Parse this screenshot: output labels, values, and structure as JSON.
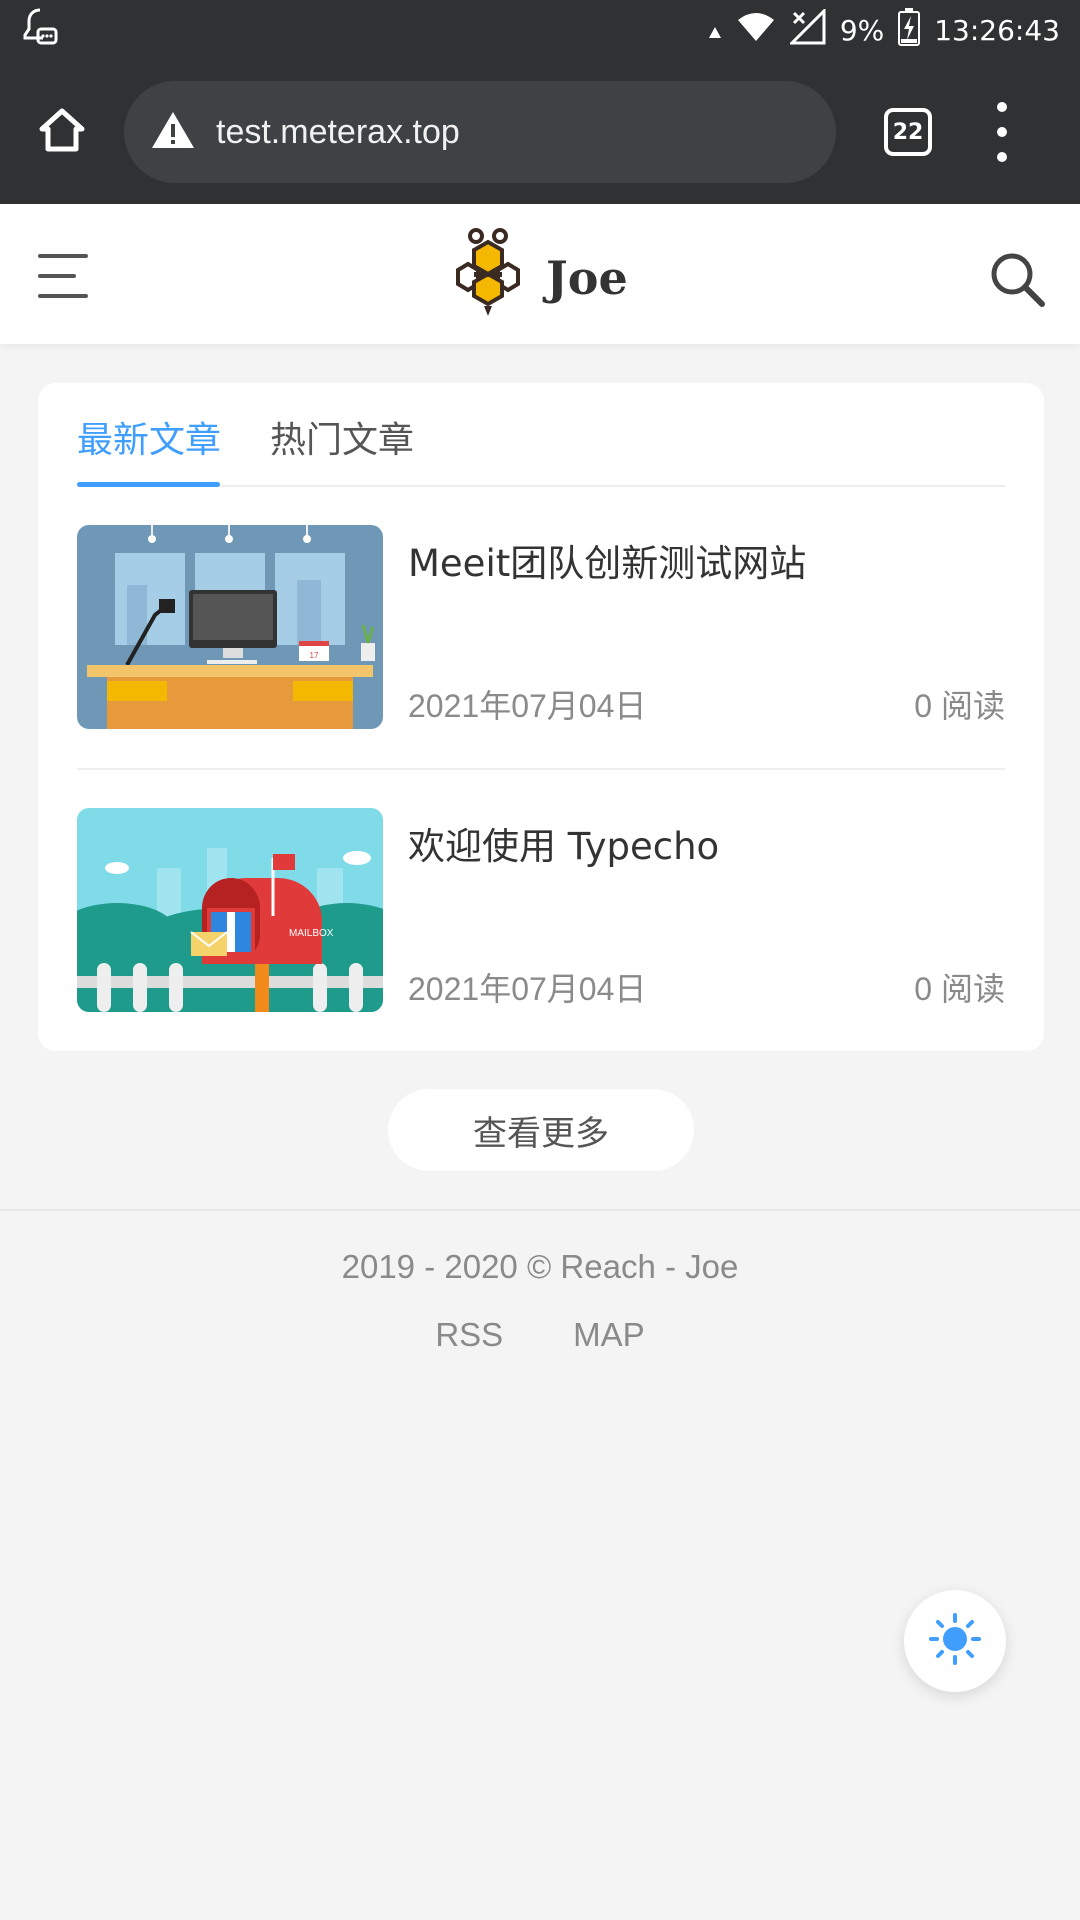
{
  "status_bar": {
    "battery": "9%",
    "time": "13:26:43"
  },
  "browser": {
    "url": "test.meterax.top",
    "tab_count": "22"
  },
  "header": {
    "logo_text": "Joe"
  },
  "tabs": [
    {
      "label": "最新文章",
      "active": true
    },
    {
      "label": "热门文章",
      "active": false
    }
  ],
  "posts": [
    {
      "title": "Meeit团队创新测试网站",
      "date": "2021年07月04日",
      "reads": "0 阅读"
    },
    {
      "title": "欢迎使用 Typecho",
      "date": "2021年07月04日",
      "reads": "0 阅读"
    }
  ],
  "more_button": "查看更多",
  "footer": {
    "copyright": "2019 - 2020 © Reach - Joe",
    "links": [
      "RSS",
      "MAP"
    ]
  },
  "colors": {
    "accent": "#409eff",
    "status_bar": "#2f3133",
    "url_box": "#3e4245",
    "page_bg": "#f4f4f4"
  },
  "mailbox_label": "MAILBOX",
  "calendar_label": "17"
}
